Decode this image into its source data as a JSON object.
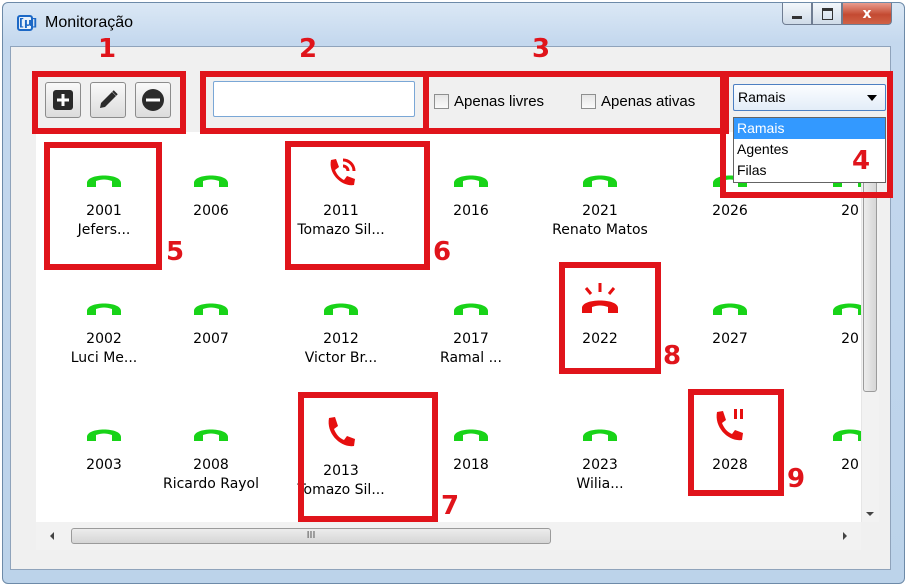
{
  "window": {
    "title": "Monitoração",
    "app_icon_glyph": "[μ]",
    "close_glyph": "x"
  },
  "toolbar": {
    "add_icon": "add-icon",
    "edit_icon": "edit-icon",
    "remove_icon": "remove-icon"
  },
  "search": {
    "value": "",
    "placeholder": ""
  },
  "filters": {
    "free_only": "Apenas livres",
    "active_only": "Apenas ativas"
  },
  "view_select": {
    "selected": "Ramais",
    "options": [
      "Ramais",
      "Agentes",
      "Filas"
    ]
  },
  "extensions": [
    {
      "number": "2001",
      "name": "Jefers...",
      "status": "free"
    },
    {
      "number": "2006",
      "name": "",
      "status": "free"
    },
    {
      "number": "2011",
      "name": "Tomazo Sil...",
      "status": "incoming"
    },
    {
      "number": "2016",
      "name": "",
      "status": "free"
    },
    {
      "number": "2021",
      "name": "Renato Matos",
      "status": "free"
    },
    {
      "number": "2026",
      "name": "",
      "status": "free"
    },
    {
      "number": "20",
      "name": "",
      "status": "free"
    },
    {
      "number": "2002",
      "name": "Luci Me...",
      "status": "free"
    },
    {
      "number": "2007",
      "name": "",
      "status": "free"
    },
    {
      "number": "2012",
      "name": "Victor Br...",
      "status": "free"
    },
    {
      "number": "2017",
      "name": "Ramal ...",
      "status": "free"
    },
    {
      "number": "2022",
      "name": "",
      "status": "ringing"
    },
    {
      "number": "2027",
      "name": "",
      "status": "free"
    },
    {
      "number": "20",
      "name": "",
      "status": "free"
    },
    {
      "number": "2003",
      "name": "",
      "status": "free"
    },
    {
      "number": "2008",
      "name": "Ricardo Rayol",
      "status": "free"
    },
    {
      "number": "2013",
      "name": "Tomazo Sil...",
      "status": "busy"
    },
    {
      "number": "2018",
      "name": "",
      "status": "free"
    },
    {
      "number": "2023",
      "name": "Wilia...",
      "status": "free"
    },
    {
      "number": "2028",
      "name": "",
      "status": "paused"
    },
    {
      "number": "20",
      "name": "",
      "status": "free"
    }
  ],
  "scrollbar": {
    "h_thumb_grip": "III"
  },
  "annotations": [
    "1",
    "2",
    "3",
    "4",
    "5",
    "6",
    "7",
    "8",
    "9"
  ],
  "colors": {
    "free": "#18d318",
    "busy": "#e60f0f",
    "annotation": "#e0141b"
  }
}
